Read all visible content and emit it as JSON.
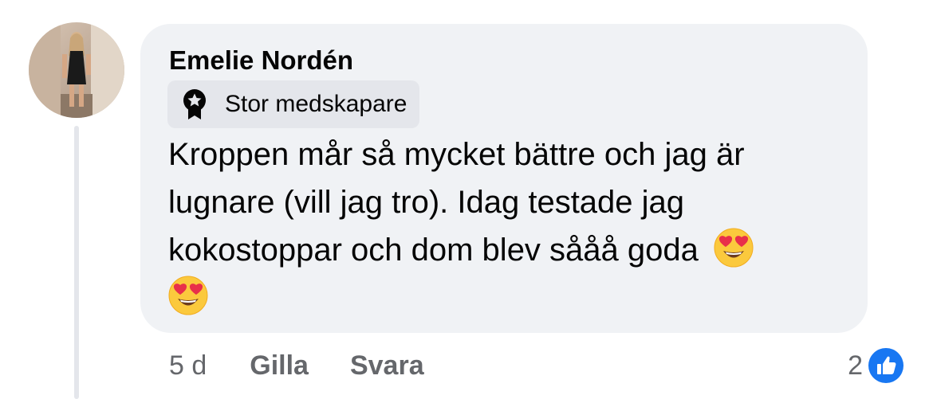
{
  "comment": {
    "author": "Emelie Nordén",
    "badge_label": "Stor medskapare",
    "badge_icon": "top-contributor-badge-icon",
    "text": "Kroppen mår så mycket bättre och jag är lugnare (vill jag tro). Idag testade jag kokostoppar och dom blev sååå goda",
    "emojis": [
      "😍",
      "😍"
    ],
    "timestamp": "5 d",
    "like_label": "Gilla",
    "reply_label": "Svara",
    "reaction_count": "2",
    "reaction_icon": "like-reaction-icon"
  },
  "colors": {
    "bubble": "#f0f2f5",
    "badge": "#e4e6eb",
    "secondary_text": "#65676b",
    "like_blue": "#1877f2"
  }
}
